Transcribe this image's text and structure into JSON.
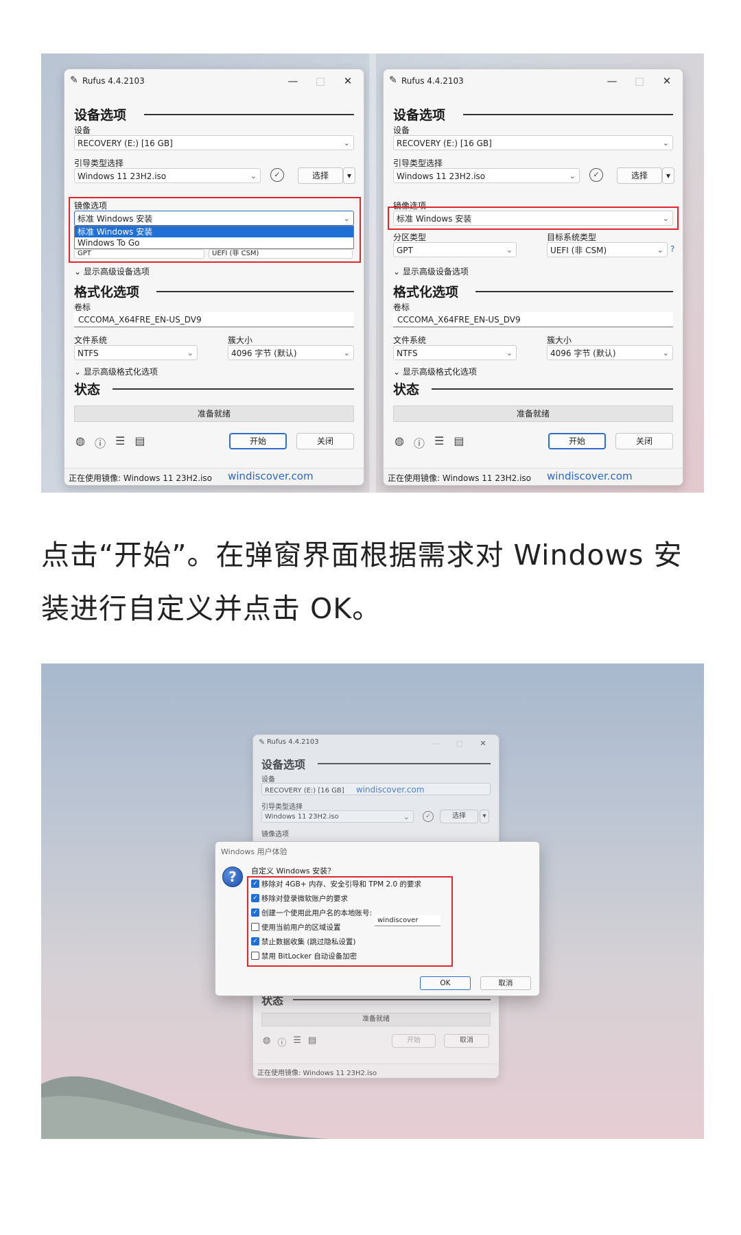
{
  "app_title": "Rufus 4.4.2103",
  "titlebar": {
    "minimize": "—",
    "maximize": "□",
    "close": "✕",
    "app_icon": "usb-drive-icon"
  },
  "sections": {
    "drive": "设备选项",
    "format": "格式化选项",
    "status": "状态"
  },
  "labels": {
    "device": "设备",
    "boot_selection": "引导类型选择",
    "image_option": "镜像选项",
    "partition_scheme": "分区类型",
    "target_system": "目标系统类型",
    "volume_label": "卷标",
    "file_system": "文件系统",
    "cluster_size": "簇大小",
    "advanced_drive": "显示高级设备选项",
    "advanced_format": "显示高级格式化选项"
  },
  "values": {
    "device": "RECOVERY (E:) [16 GB]",
    "boot_selection": "Windows 11 23H2.iso",
    "image_option": "标准 Windows 安装",
    "partition_scheme": "GPT",
    "target_system": "UEFI (非 CSM)",
    "volume_label": "CCCOMA_X64FRE_EN-US_DV9",
    "file_system": "NTFS",
    "cluster_size": "4096 字节 (默认)",
    "status": "准备就绪"
  },
  "image_options_list": [
    "标准 Windows 安装",
    "Windows To Go"
  ],
  "buttons": {
    "select": "选择",
    "start": "开始",
    "close": "关闭",
    "cancel": "取消",
    "check_icon": "✓",
    "help": "?"
  },
  "toolbar_icons": [
    "globe-icon",
    "info-icon",
    "settings-icon",
    "log-icon"
  ],
  "footer": {
    "text": "正在使用镜像: Windows 11 23H2.iso",
    "watermark": "windiscover.com"
  },
  "caption": "点击“开始”。在弹窗界面根据需求对 Windows 安装进行自定义并点击 OK。",
  "dialog": {
    "title": "Windows 用户体验",
    "question": "自定义 Windows 安装？",
    "options": [
      {
        "label": "移除对 4GB+ 内存、安全引导和 TPM 2.0 的要求",
        "checked": true
      },
      {
        "label": "移除对登录微软账户的要求",
        "checked": true
      },
      {
        "label": "创建一个使用此用户名的本地账号:",
        "checked": true
      },
      {
        "label": "使用当前用户的区域设置",
        "checked": false
      },
      {
        "label": "禁止数据收集 (跳过隐私设置)",
        "checked": true
      },
      {
        "label": "禁用 BitLocker 自动设备加密",
        "checked": false
      }
    ],
    "account_name": "windiscover",
    "ok": "OK",
    "cancel": "取消"
  },
  "accent_colors": {
    "highlight": "#e0262f",
    "selection": "#1f6fd6",
    "watermark": "#2a67c6"
  }
}
